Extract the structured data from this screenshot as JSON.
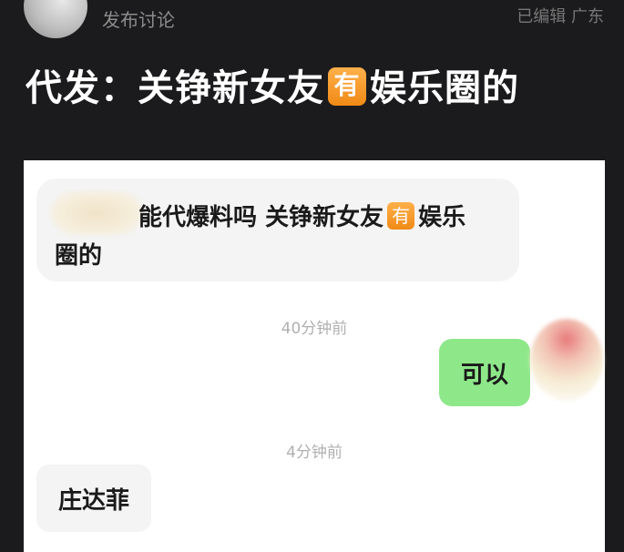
{
  "header": {
    "meta_label": "发布讨论",
    "edited_location": "已编辑 广东"
  },
  "post": {
    "title_part1": "代发：关铮新女友",
    "badge": "有",
    "title_part2": "娱乐圈的"
  },
  "chat": {
    "messages": [
      {
        "side": "left",
        "line1_a": "能代爆料吗 关铮新女友",
        "badge": "有",
        "line1_b": "娱乐",
        "line2": "圈的"
      },
      {
        "timestamp": "40分钟前"
      },
      {
        "side": "right",
        "text": "可以"
      },
      {
        "timestamp": "4分钟前"
      },
      {
        "side": "left",
        "text": "庄达菲"
      }
    ]
  },
  "colors": {
    "background": "#1b1b1d",
    "sent_bubble": "#8ee88a",
    "received_bubble": "#f4f4f4",
    "badge": "#f08a16"
  }
}
